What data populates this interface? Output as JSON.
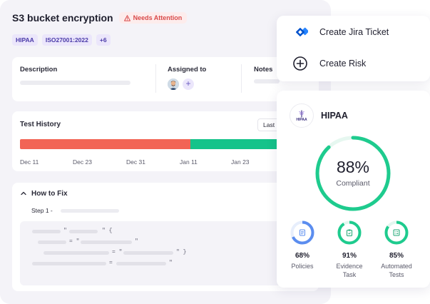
{
  "header": {
    "title": "S3 bucket encryption",
    "status_badge": "Needs Attention",
    "tags": [
      "HIPAA",
      "ISO27001:2022",
      "+6"
    ]
  },
  "info": {
    "description_label": "Description",
    "assigned_label": "Assigned to",
    "notes_label": "Notes"
  },
  "history": {
    "title": "Test History",
    "range_select": "Last",
    "fail_fraction": 0.63,
    "dates": [
      "Dec 11",
      "Dec 23",
      "Dec 31",
      "Jan 11",
      "Jan 23"
    ]
  },
  "fix": {
    "title": "How to Fix",
    "step_label": "Step 1 -"
  },
  "actions": {
    "jira_label": "Create Jira Ticket",
    "risk_label": "Create Risk"
  },
  "compliance": {
    "framework_name": "HIPAA",
    "logo_text": "HIPAA",
    "percent_text": "88%",
    "percent_value": 88,
    "status_text": "Compliant",
    "metrics": [
      {
        "value": 68,
        "pct_text": "68%",
        "label_line1": "Policies",
        "label_line2": "",
        "icon": "document-icon"
      },
      {
        "value": 91,
        "pct_text": "91%",
        "label_line1": "Evidence",
        "label_line2": "Task",
        "icon": "clipboard-icon"
      },
      {
        "value": 85,
        "pct_text": "85%",
        "label_line1": "Automated",
        "label_line2": "Tests",
        "icon": "list-check-icon"
      }
    ]
  },
  "colors": {
    "accent_purple": "#4a3aa8",
    "attention_red": "#d94a4a",
    "fail_red": "#f26455",
    "pass_green": "#15c38a",
    "policies_blue": "#5b8def",
    "jira_blue": "#2684ff"
  }
}
